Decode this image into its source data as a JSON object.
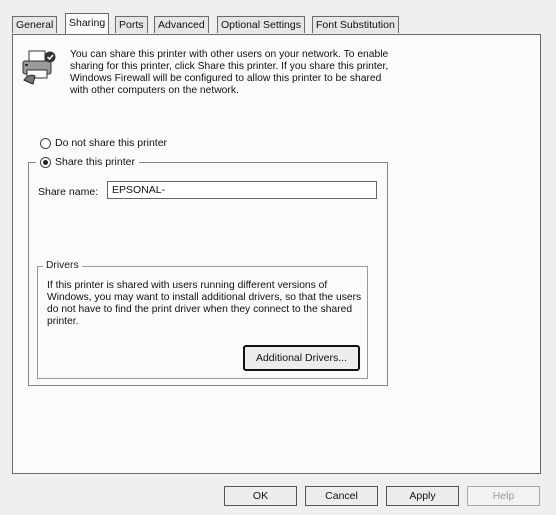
{
  "tabs": [
    "General",
    "Sharing",
    "Ports",
    "Advanced",
    "Optional Settings",
    "Font Substitution"
  ],
  "active_tab": "Sharing",
  "intro_text": "You can share this printer with other users on your network. To enable sharing for this printer, click Share this printer. If you share this printer, Windows Firewall will be configured to allow this printer to be shared with other computers on the network.",
  "sharing": {
    "do_not_share_label": "Do not share this printer",
    "share_label": "Share this printer",
    "selected": "share",
    "share_name_label": "Share name:",
    "share_name_value": "EPSONAL-"
  },
  "drivers": {
    "legend": "Drivers",
    "text": "If this printer is shared with users running different versions of Windows, you may want to install additional drivers, so that the users do not have to find the print driver when they connect to the shared printer.",
    "button_label": "Additional Drivers..."
  },
  "footer": {
    "ok_label": "OK",
    "cancel_label": "Cancel",
    "apply_label": "Apply",
    "help_label": "Help"
  },
  "icons": {
    "printer": "printer-share-icon"
  }
}
